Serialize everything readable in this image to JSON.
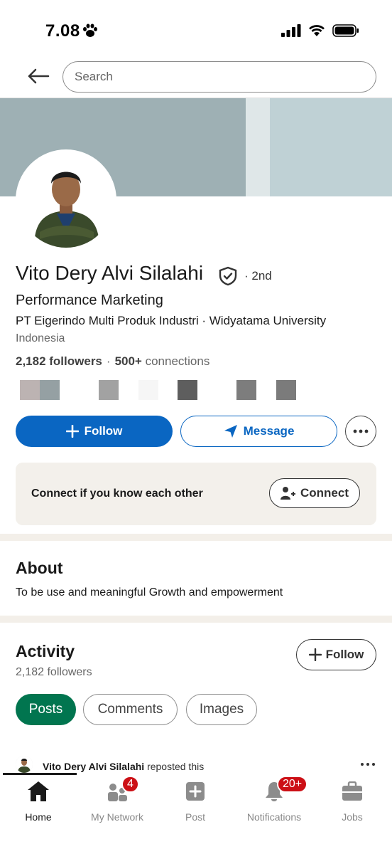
{
  "status": {
    "time": "7.08",
    "signal_icon": "signal-bars-icon",
    "wifi_icon": "wifi-icon",
    "battery_icon": "battery-icon",
    "status_glyph": "paw-icon"
  },
  "search": {
    "placeholder": "Search"
  },
  "profile": {
    "name": "Vito Dery Alvi Silalahi",
    "degree": "· 2nd",
    "headline": "Performance Marketing",
    "company_line": "PT Eigerindo Multi Produk Industri · Widyatama University",
    "location": "Indonesia",
    "followers_count": "2,182 followers",
    "separator": "·",
    "connections_count": "500+",
    "connections_label": "connections"
  },
  "actions": {
    "follow": "Follow",
    "message": "Message"
  },
  "connect_card": {
    "text": "Connect if you know each other",
    "button": "Connect"
  },
  "about": {
    "title": "About",
    "text": "To be use and meaningful Growth and empowerment"
  },
  "activity": {
    "title": "Activity",
    "followers": "2,182 followers",
    "follow_button": "Follow",
    "filters": [
      "Posts",
      "Comments",
      "Images"
    ],
    "selected_filter": "Posts",
    "post": {
      "author": "Vito Dery Alvi Silalahi",
      "action": "reposted this"
    }
  },
  "bottom_nav": {
    "items": [
      {
        "label": "Home",
        "icon": "home-icon"
      },
      {
        "label": "My Network",
        "icon": "network-icon",
        "badge": "4"
      },
      {
        "label": "Post",
        "icon": "post-icon"
      },
      {
        "label": "Notifications",
        "icon": "bell-icon",
        "badge": "20+"
      },
      {
        "label": "Jobs",
        "icon": "briefcase-icon"
      }
    ],
    "active": "Home"
  },
  "colors": {
    "brand_blue": "#0a66c2",
    "active_pill": "#01754f",
    "badge_red": "#cc1016",
    "banner": "#9eb0b4"
  }
}
